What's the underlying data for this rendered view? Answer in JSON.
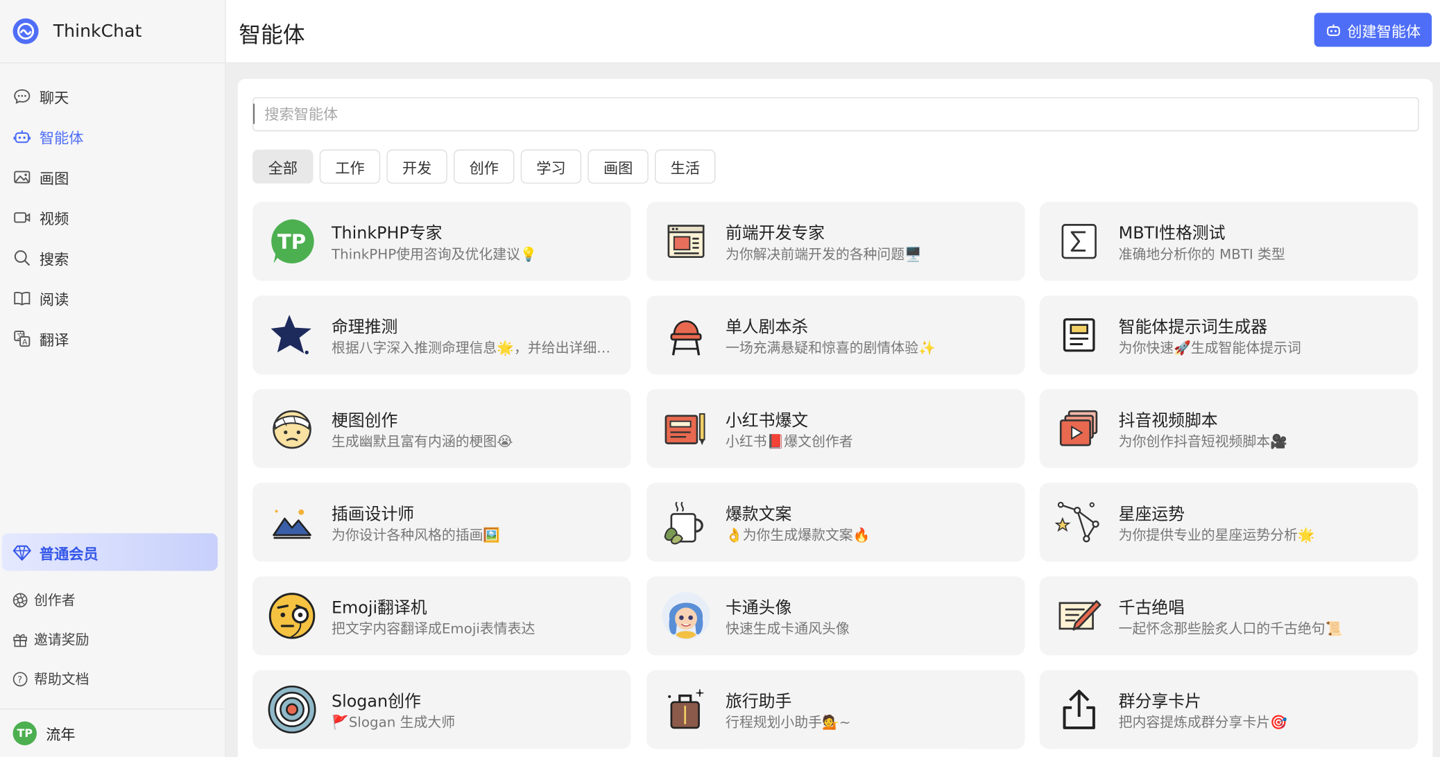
{
  "app": {
    "name": "ThinkChat"
  },
  "sidebar": {
    "nav": [
      {
        "label": "聊天",
        "icon": "chat-bubble-icon"
      },
      {
        "label": "智能体",
        "icon": "robot-icon",
        "active": true
      },
      {
        "label": "画图",
        "icon": "image-icon"
      },
      {
        "label": "视频",
        "icon": "video-camera-icon"
      },
      {
        "label": "搜索",
        "icon": "search-icon"
      },
      {
        "label": "阅读",
        "icon": "open-book-icon"
      },
      {
        "label": "翻译",
        "icon": "translate-icon"
      }
    ],
    "membership": {
      "label": "普通会员",
      "icon": "diamond-icon"
    },
    "bottom_nav": [
      {
        "label": "创作者",
        "icon": "aperture-icon"
      },
      {
        "label": "邀请奖励",
        "icon": "gift-icon"
      },
      {
        "label": "帮助文档",
        "icon": "help-circle-icon"
      }
    ],
    "user": {
      "avatar_text": "TP",
      "name": "流年"
    }
  },
  "header": {
    "title": "智能体",
    "create_button": "创建智能体"
  },
  "search": {
    "placeholder": "搜索智能体",
    "value": ""
  },
  "categories": [
    "全部",
    "工作",
    "开发",
    "创作",
    "学习",
    "画图",
    "生活"
  ],
  "active_category": "全部",
  "agents": [
    {
      "title": "ThinkPHP专家",
      "desc": "ThinkPHP使用咨询及优化建议💡",
      "icon": "thinkphp-logo-icon"
    },
    {
      "title": "前端开发专家",
      "desc": "为你解决前端开发的各种问题🖥️",
      "icon": "browser-window-icon"
    },
    {
      "title": "MBTI性格测试",
      "desc": "准确地分析你的 MBTI 类型",
      "icon": "sigma-icon"
    },
    {
      "title": "命理推测",
      "desc": "根据八字深入推测命理信息🌟，并给出详细的建议",
      "icon": "star-icon"
    },
    {
      "title": "单人剧本杀",
      "desc": "一场充满悬疑和惊喜的剧情体验✨",
      "icon": "chair-icon"
    },
    {
      "title": "智能体提示词生成器",
      "desc": "为你快速🚀生成智能体提示词",
      "icon": "document-icon"
    },
    {
      "title": "梗图创作",
      "desc": "生成幽默且富有内涵的梗图😭",
      "icon": "bandaged-face-icon"
    },
    {
      "title": "小红书爆文",
      "desc": "小红书📕爆文创作者",
      "icon": "notebook-icon"
    },
    {
      "title": "抖音视频脚本",
      "desc": "为你创作抖音短视频脚本🎥",
      "icon": "video-stack-icon"
    },
    {
      "title": "插画设计师",
      "desc": "为你设计各种风格的插画🖼️",
      "icon": "mountain-picture-icon"
    },
    {
      "title": "爆款文案",
      "desc": "👌为你生成爆款文案🔥",
      "icon": "coffee-mug-icon"
    },
    {
      "title": "星座运势",
      "desc": "为你提供专业的星座运势分析🌟",
      "icon": "constellation-icon"
    },
    {
      "title": "Emoji翻译机",
      "desc": "把文字内容翻译成Emoji表情表达",
      "icon": "monocle-face-icon"
    },
    {
      "title": "卡通头像",
      "desc": "快速生成卡通风头像",
      "icon": "cartoon-avatar-icon"
    },
    {
      "title": "千古绝唱",
      "desc": "一起怀念那些脍炙人口的千古绝句📜",
      "icon": "writing-pen-icon"
    },
    {
      "title": "Slogan创作",
      "desc": "🚩Slogan 生成大师",
      "icon": "target-icon"
    },
    {
      "title": "旅行助手",
      "desc": "行程规划小助手💁~",
      "icon": "luggage-icon"
    },
    {
      "title": "群分享卡片",
      "desc": "把内容提炼成群分享卡片🎯",
      "icon": "share-upload-icon"
    }
  ],
  "colors": {
    "accent": "#4f6ef7",
    "sidebar_bg": "#f6f6f6",
    "card_bg": "#f4f4f4",
    "content_bg": "#eeeeee"
  }
}
